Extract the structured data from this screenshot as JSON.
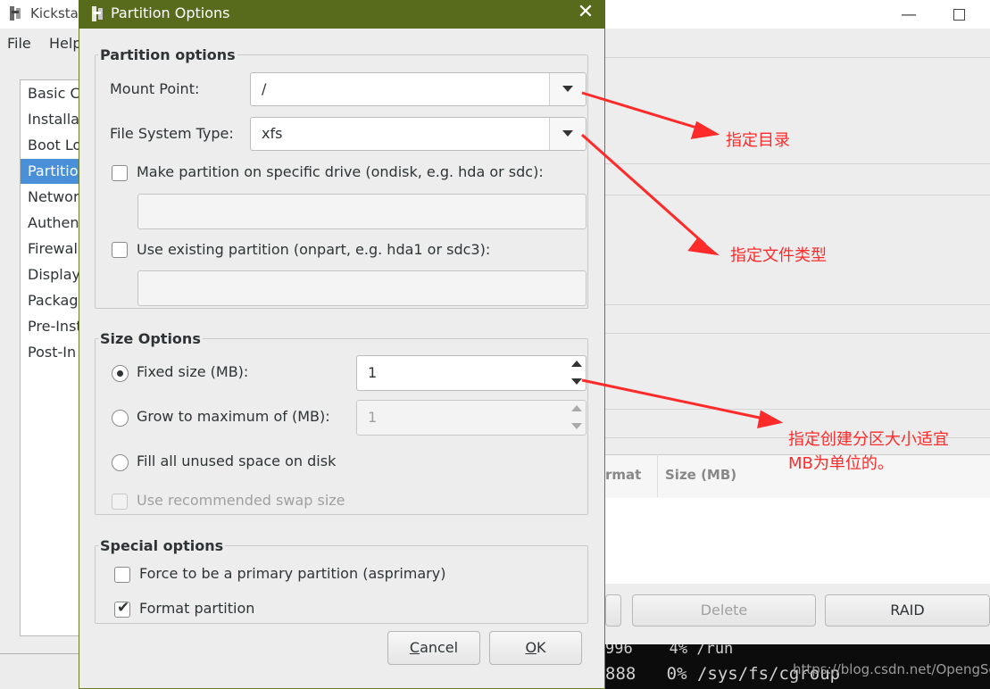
{
  "background_window": {
    "title": "Kickstar",
    "menu": [
      "File",
      "Help"
    ],
    "sidebar_items": [
      "Basic Configuration",
      "Installation Method",
      "Boot Loader Options",
      "Partition Information",
      "Network Configuration",
      "Authentication",
      "Firewall Configuration",
      "Display Configuration",
      "Package Selection",
      "Pre-Installation Script",
      "Post-Installation Script"
    ],
    "sidebar_visible": [
      "Basic C",
      "Installa",
      "Boot Lo",
      "Partitio",
      "Networ",
      "Authen",
      "Firewal",
      "Display",
      "Packag",
      "Pre-Inst",
      "Post-In"
    ],
    "selected_sidebar_index": 3,
    "table_columns": [
      "rmat",
      "Size (MB)"
    ],
    "buttons": [
      "Delete",
      "RAID"
    ]
  },
  "terminal": {
    "line1": "996    4% /run",
    "line2": "888   0% /sys/fs/cgroup"
  },
  "watermark": "https://blog.csdn.net/OpengSd",
  "dialog": {
    "title": "Partition Options",
    "partition_options": {
      "heading": "Partition options",
      "mount_point_label": "Mount Point:",
      "mount_point_value": "/",
      "fs_type_label": "File System Type:",
      "fs_type_value": "xfs",
      "ondisk_label": "Make partition on specific drive (ondisk, e.g. hda or sdc):",
      "ondisk_checked": false,
      "ondisk_value": "",
      "onpart_label": "Use existing partition (onpart, e.g. hda1 or sdc3):",
      "onpart_checked": false,
      "onpart_value": ""
    },
    "size_options": {
      "heading": "Size Options",
      "fixed_label": "Fixed size (MB):",
      "fixed_value": "1",
      "grow_label": "Grow to maximum of (MB):",
      "grow_value": "1",
      "fill_label": "Fill all unused space on disk",
      "swap_label": "Use recommended swap size",
      "selected": "fixed"
    },
    "special_options": {
      "heading": "Special options",
      "primary_label": "Force to be a primary partition (asprimary)",
      "primary_checked": false,
      "format_label": "Format partition",
      "format_checked": true
    },
    "cancel_label": "ancel",
    "cancel_mnemonic": "C",
    "ok_label": "K",
    "ok_mnemonic": "O"
  },
  "annotations": {
    "mount_point_note": "指定目录",
    "fs_type_note": "指定文件类型",
    "size_note_line1": "指定创建分区大小适宜",
    "size_note_line2": "MB为单位的。",
    "color": "#ff2a2a"
  },
  "colors": {
    "dialog_titlebar": "#586b1c",
    "selection": "#4a90d9"
  }
}
